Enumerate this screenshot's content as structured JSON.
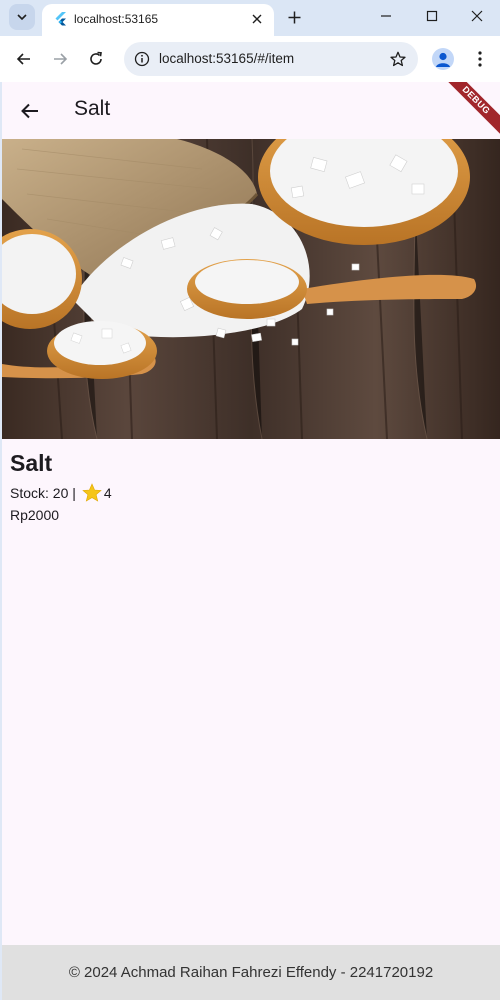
{
  "browser": {
    "tab_title": "localhost:53165",
    "url": "localhost:53165/#/item"
  },
  "appbar": {
    "title": "Salt"
  },
  "debug_banner": "DEBUG",
  "product": {
    "name": "Salt",
    "stock_text": "Stock: 20 |",
    "rating": "4",
    "price": "Rp2000"
  },
  "footer": {
    "text": "© 2024 Achmad Raihan Fahrezi Effendy - 2241720192"
  },
  "colors": {
    "app_background": "#fdf6fd",
    "debug_banner": "#a1262b",
    "star": "#f5c518",
    "footer_background": "#e0e0e0"
  }
}
